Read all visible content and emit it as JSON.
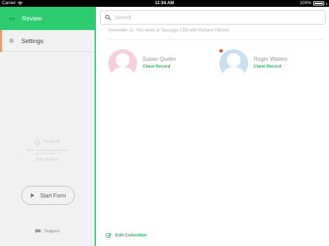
{
  "status_bar": {
    "carrier": "Carrier",
    "time": "11:34 AM",
    "battery": "100%"
  },
  "sidebar": {
    "items": [
      {
        "label": "Review",
        "icon": "eye-icon",
        "active": true
      },
      {
        "label": "Settings",
        "icon": "gear-icon",
        "active": false
      }
    ],
    "brand_name": "Fingerink",
    "brand_text_line1": "PMG is a biometrical enabled Fingerink",
    "brand_text_line2": "and Josh Fernando. ®",
    "signature": "fabi Josilva",
    "start_form_label": "Start Form",
    "support_label": "Support"
  },
  "main": {
    "search_placeholder": "Search",
    "session_info": "November 11, This week at Tauranga CBD with Richard Fillmore",
    "clients": [
      {
        "name": "Susan Quelm",
        "link": "Client Record",
        "avatar_color": "#f6cfdc",
        "has_notification": false
      },
      {
        "name": "Roger Waters",
        "link": "Client Record",
        "avatar_color": "#c8e0ef",
        "has_notification": true
      }
    ],
    "edit_collection_label": "Edit Collection"
  },
  "colors": {
    "accent": "#2ecc71",
    "link": "#27ae60",
    "notification": "#e04f2b"
  }
}
